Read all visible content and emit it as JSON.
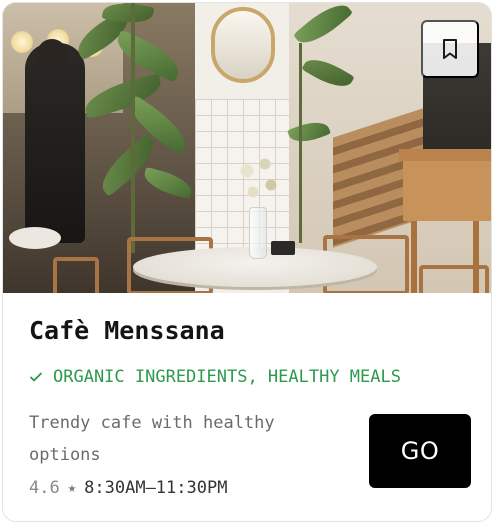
{
  "cafe": {
    "name": "Cafè Menssana",
    "tag": "ORGANIC INGREDIENTS, HEALTHY MEALS",
    "description": "Trendy cafe with healthy options",
    "rating": "4.6",
    "rating_symbol": "★",
    "hours": "8:30AM–11:30PM"
  },
  "actions": {
    "go_label": "GO"
  },
  "icons": {
    "bookmark": "bookmark-icon",
    "check": "check-icon",
    "star": "star-icon"
  },
  "colors": {
    "tag_green": "#2e9a4c",
    "button_black": "#000000",
    "title": "#141414",
    "muted_text": "#6b6b6b"
  }
}
